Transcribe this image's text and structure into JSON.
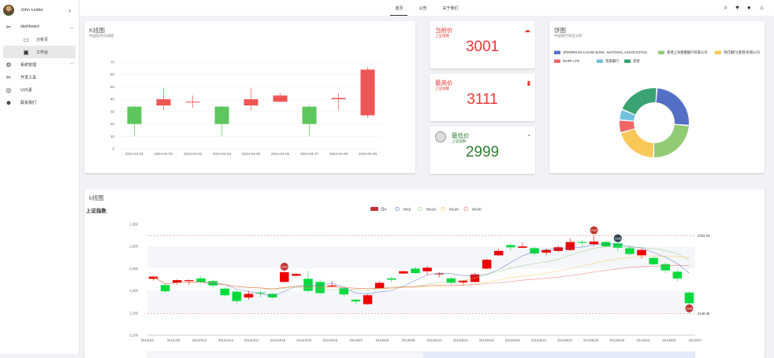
{
  "user": {
    "name": "John Leider"
  },
  "sidebar": {
    "items": [
      {
        "label": "dashboard",
        "icon": "tools-icon"
      },
      {
        "label": "分析页",
        "icon": "document-icon"
      },
      {
        "label": "工作台",
        "icon": "monitor-icon"
      },
      {
        "label": "系统管理",
        "icon": "gears-icon"
      },
      {
        "label": "开发工具",
        "icon": "tools-icon"
      },
      {
        "label": "UI元素",
        "icon": "palette-icon"
      },
      {
        "label": "联系我们",
        "icon": "contact-icon"
      }
    ]
  },
  "nav": {
    "tabs": [
      "首页",
      "公告",
      "关于我们"
    ]
  },
  "kline_card": {
    "title": "K线图",
    "subtitle": "中国软件日线图"
  },
  "current_price": {
    "title": "当前价",
    "subtitle": "上证指数",
    "value": "3001",
    "color": "#e53935"
  },
  "high_price": {
    "title": "最高价",
    "subtitle": "上证指数",
    "value": "3111",
    "color": "#e53935"
  },
  "low_price": {
    "title": "最低价",
    "subtitle": "上证指数",
    "value": "2999",
    "color": "#2e7d32"
  },
  "pie_card": {
    "title": "饼图",
    "subtitle": "中国银行排名分析"
  },
  "bottom_card": {
    "title": "k线图",
    "chart_label": "上证指数"
  },
  "colors": {
    "up": "#ee5555",
    "down": "#5dc75d",
    "accent_red": "#e53935",
    "accent_green": "#2e7d32"
  },
  "chart_data": [
    {
      "type": "candlestick",
      "categories": [
        "2024-04-01",
        "2024-04-02",
        "2024-04-03",
        "2024-04-04",
        "2024-04-05",
        "2024-04-06",
        "2024-04-07",
        "2024-04-08",
        "2024-04-09"
      ],
      "ohlc": [
        [
          34,
          20,
          35,
          10
        ],
        [
          35,
          40,
          49,
          31
        ],
        [
          38,
          38,
          43,
          33
        ],
        [
          34,
          20,
          35,
          10
        ],
        [
          35,
          40,
          49,
          31
        ],
        [
          38,
          43,
          45,
          38
        ],
        [
          34,
          20,
          35,
          10
        ],
        [
          40,
          41,
          45,
          31
        ],
        [
          27,
          64,
          66,
          25
        ]
      ],
      "ylim": [
        0,
        70
      ],
      "yticks": [
        0,
        10,
        20,
        30,
        40,
        50,
        60,
        70
      ]
    },
    {
      "type": "pie",
      "legend": [
        "JPMORGAN CHASE BANK, NATIONAL ASSOCIATION",
        "香港上海滙豐銀行有限公司",
        "渣打銀行(香港)有限公司",
        "MUFE LTD",
        "花旗銀行",
        "其他"
      ],
      "values": [
        25,
        24,
        20,
        6,
        5,
        20
      ],
      "colors": [
        "#5470c6",
        "#91cc75",
        "#fac858",
        "#ee6666",
        "#73c0de",
        "#3ba272"
      ]
    },
    {
      "type": "candlestick",
      "title": "上证指数",
      "legend": [
        "日K",
        "MA5",
        "MA10",
        "MA20",
        "MA30"
      ],
      "legend_colors": [
        "#c23531",
        "#5470c6",
        "#91cc75",
        "#fac858",
        "#ee6666"
      ],
      "x_labels": [
        "2013/4/3",
        "2013/4/9",
        "2013/4/11",
        "2013/4/15",
        "2013/4/17",
        "2013/4/19",
        "2013/4/23",
        "2013/4/25",
        "2013/5/2",
        "2013/5/6",
        "2013/5/8",
        "2013/5/10",
        "2013/5/14",
        "2013/5/16",
        "2013/5/20",
        "2013/5/22",
        "2013/5/24",
        "2013/5/28",
        "2013/5/30",
        "2013/6/3",
        "2013/6/5",
        "2013/6/7"
      ],
      "ylim": [
        2100,
        2350
      ],
      "yticks": [
        2100,
        2150,
        2200,
        2250,
        2300,
        2350
      ],
      "mark_lines": [
        {
          "label": "2324.02",
          "value": 2324.02
        },
        {
          "label": "2148.35",
          "value": 2148.35
        }
      ],
      "mark_points": [
        {
          "label": "2242",
          "value": 2242
        },
        {
          "label": "2324",
          "value": 2324
        },
        {
          "label": "2306",
          "value": 2306
        },
        {
          "label": "2148",
          "value": 2148
        }
      ],
      "ohlc": [
        [
          2227,
          2232,
          2234,
          2223
        ],
        [
          2213,
          2199,
          2215,
          2196
        ],
        [
          2218,
          2224,
          2226,
          2214
        ],
        [
          2222,
          2224,
          2226,
          2213
        ],
        [
          2228,
          2219,
          2233,
          2215
        ],
        [
          2222,
          2212,
          2225,
          2208
        ],
        [
          2205,
          2190,
          2208,
          2188
        ],
        [
          2198,
          2177,
          2201,
          2172
        ],
        [
          2185,
          2193,
          2200,
          2180
        ],
        [
          2196,
          2195,
          2200,
          2185
        ],
        [
          2193,
          2185,
          2195,
          2183
        ],
        [
          2220,
          2242,
          2244,
          2218
        ],
        [
          2234,
          2238,
          2240,
          2232
        ],
        [
          2227,
          2200,
          2245,
          2196
        ],
        [
          2220,
          2195,
          2225,
          2192
        ],
        [
          2210,
          2212,
          2222,
          2208
        ],
        [
          2206,
          2192,
          2211,
          2186
        ],
        [
          2180,
          2176,
          2182,
          2170
        ],
        [
          2170,
          2190,
          2192,
          2168
        ],
        [
          2205,
          2218,
          2222,
          2205
        ],
        [
          2228,
          2225,
          2232,
          2220
        ],
        [
          2239,
          2244,
          2246,
          2238
        ],
        [
          2250,
          2240,
          2254,
          2238
        ],
        [
          2244,
          2252,
          2256,
          2236
        ],
        [
          2238,
          2239,
          2242,
          2230
        ],
        [
          2228,
          2218,
          2232,
          2214
        ],
        [
          2219,
          2223,
          2224,
          2214
        ],
        [
          2220,
          2237,
          2240,
          2219
        ],
        [
          2250,
          2270,
          2272,
          2249
        ],
        [
          2280,
          2290,
          2295,
          2278
        ],
        [
          2303,
          2298,
          2305,
          2290
        ],
        [
          2297,
          2300,
          2310,
          2296
        ],
        [
          2296,
          2284,
          2299,
          2280
        ],
        [
          2286,
          2292,
          2296,
          2280
        ],
        [
          2290,
          2298,
          2302,
          2287
        ],
        [
          2292,
          2310,
          2318,
          2290
        ],
        [
          2310,
          2308,
          2314,
          2300
        ],
        [
          2305,
          2311,
          2324,
          2301
        ],
        [
          2310,
          2300,
          2312,
          2298
        ],
        [
          2307,
          2297,
          2310,
          2289
        ],
        [
          2296,
          2283,
          2301,
          2280
        ],
        [
          2280,
          2292,
          2295,
          2272
        ],
        [
          2274,
          2260,
          2276,
          2257
        ],
        [
          2260,
          2246,
          2264,
          2240
        ],
        [
          2243,
          2228,
          2248,
          2222
        ],
        [
          2196,
          2172,
          2199,
          2148
        ]
      ]
    }
  ]
}
